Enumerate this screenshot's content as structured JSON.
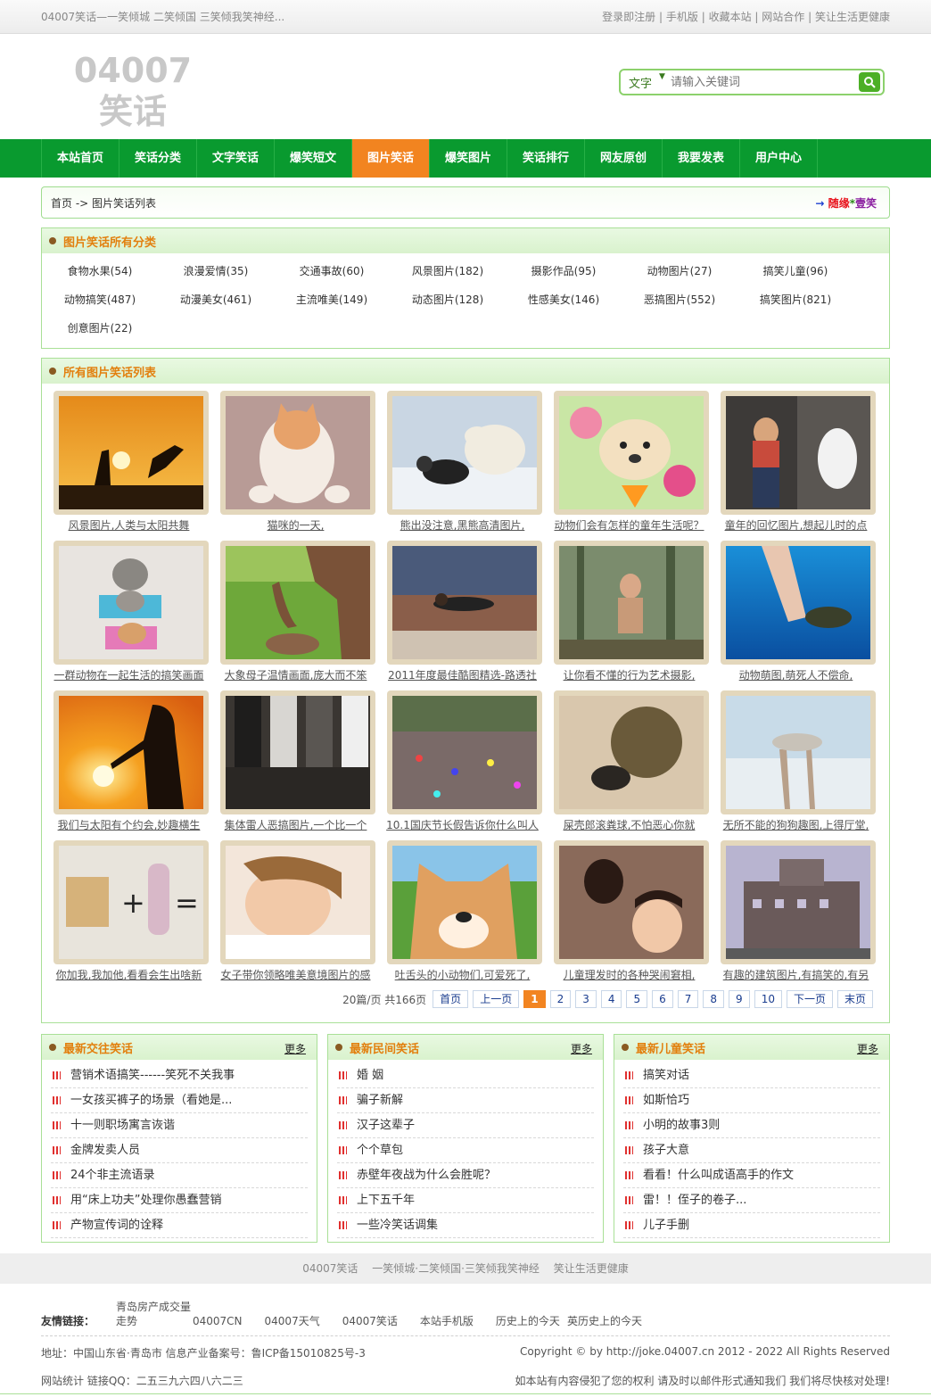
{
  "topbar": {
    "slogan": "04007笑话—一笑倾城 二笑倾国 三笑倾我笑神经...",
    "links": [
      "登录即注册",
      "手机版",
      "收藏本站",
      "网站合作",
      "笑让生活更健康"
    ]
  },
  "header": {
    "logo": "04007笑话",
    "search_type": "文字",
    "search_placeholder": "请输入关键词"
  },
  "nav": [
    {
      "label": "本站首页",
      "active": false
    },
    {
      "label": "笑话分类",
      "active": false
    },
    {
      "label": "文字笑话",
      "active": false
    },
    {
      "label": "爆笑短文",
      "active": false
    },
    {
      "label": "图片笑话",
      "active": true
    },
    {
      "label": "爆笑图片",
      "active": false
    },
    {
      "label": "笑话排行",
      "active": false
    },
    {
      "label": "网友原创",
      "active": false
    },
    {
      "label": "我要发表",
      "active": false
    },
    {
      "label": "用户中心",
      "active": false
    }
  ],
  "crumb": {
    "path": "首页 -> 图片笑话列表",
    "random_arrow": "→",
    "random_a": "随",
    "random_b": "缘",
    "random_c": "*",
    "random_d": "壹笑"
  },
  "categories": {
    "title": "图片笑话所有分类",
    "items": [
      "食物水果(54)",
      "浪漫爱情(35)",
      "交通事故(60)",
      "风景图片(182)",
      "摄影作品(95)",
      "动物图片(27)",
      "搞笑儿童(96)",
      "动物搞笑(487)",
      "动漫美女(461)",
      "主流唯美(149)",
      "动态图片(128)",
      "性感美女(146)",
      "恶搞图片(552)",
      "搞笑图片(821)",
      "创意图片(22)"
    ]
  },
  "list": {
    "title": "所有图片笑话列表",
    "items": [
      {
        "caption": "风景图片,人类与太阳共舞",
        "pic": "sunset-silhouette"
      },
      {
        "caption": "猫咪的一天,",
        "pic": "sleeping-cat"
      },
      {
        "caption": "熊出没注意,黑熊高清图片,",
        "pic": "polar-bear-dog"
      },
      {
        "caption": "动物们会有怎样的童年生活呢？",
        "pic": "puppy-toys"
      },
      {
        "caption": "童年的回忆图片,想起儿时的点",
        "pic": "kid-urinal"
      },
      {
        "caption": "一群动物在一起生活的搞笑画面",
        "pic": "cats-baskets"
      },
      {
        "caption": "大象母子温情画面,庞大而不笨",
        "pic": "elephant-calf"
      },
      {
        "caption": "2011年度最佳酷图精选-路透社",
        "pic": "track-athlete"
      },
      {
        "caption": "让你看不懂的行为艺术摄影,",
        "pic": "forest-man"
      },
      {
        "caption": "动物萌图,萌死人不偿命,",
        "pic": "underwater-turtle"
      },
      {
        "caption": "我们与太阳有个约会,妙趣横生",
        "pic": "sun-hands"
      },
      {
        "caption": "集体雷人恶搞图片,一个比一个",
        "pic": "crowd-legs"
      },
      {
        "caption": "10.1国庆节长假告诉你什么叫人",
        "pic": "holiday-crowd"
      },
      {
        "caption": "屎壳郎滚粪球,不怕恶心你就",
        "pic": "dung-beetle"
      },
      {
        "caption": "无所不能的狗狗趣图,上得厅堂,",
        "pic": "dog-stilts"
      },
      {
        "caption": "你加我,我加他,看看会生出啥新",
        "pic": "cat-plus-shaver"
      },
      {
        "caption": "女子带你领略唯美意境图片的感",
        "pic": "sleeping-girl"
      },
      {
        "caption": "吐舌头的小动物们,可爱死了,",
        "pic": "shiba-dog"
      },
      {
        "caption": "儿童理发时的各种哭闹窘相,",
        "pic": "baby-haircut"
      },
      {
        "caption": "有趣的建筑图片,有搞笑的,有另",
        "pic": "building"
      }
    ]
  },
  "pager": {
    "info": "20篇/页 共166页",
    "first": "首页",
    "prev": "上一页",
    "pages": [
      "1",
      "2",
      "3",
      "4",
      "5",
      "6",
      "7",
      "8",
      "9",
      "10"
    ],
    "current": "1",
    "next": "下一页",
    "last": "末页"
  },
  "bottom_boxes": [
    {
      "title": "最新交往笑话",
      "more": "更多",
      "items": [
        "营销术语搞笑------笑死不关我事",
        "一女孩买裤子的场景（看她是...",
        "十一则职场寓言诙谐",
        "金牌发卖人员",
        "24个非主流语录",
        "用“床上功夫”处理你愚蠢营销",
        "产物宣传词的诠释"
      ]
    },
    {
      "title": "最新民间笑话",
      "more": "更多",
      "items": [
        "婚 姻",
        "骗子新解",
        "汉子这辈子",
        "个个草包",
        "赤壁年夜战为什么会胜呢？",
        "上下五千年",
        "一些冷笑话调集"
      ]
    },
    {
      "title": "最新儿童笑话",
      "more": "更多",
      "items": [
        "搞笑对话",
        "如斯恰巧",
        "小明的故事3则",
        "孩子大意",
        "看看！什么叫成语高手的作文",
        "雷！！侄子的卷子...",
        "儿子手删"
      ]
    }
  ],
  "footer": {
    "nav": [
      "04007笑话",
      "一笑倾城·二笑倾国·三笑倾我笑神经",
      "笑让生活更健康"
    ],
    "friends_label": "友情链接：",
    "friends": [
      "青岛房产成交量走势",
      "04007CN",
      "04007天气",
      "04007笑话",
      "本站手机版",
      "历史上的今天",
      "英历史上的今天"
    ],
    "address": "地址：中国山东省·青岛市 信息产业备案号：鲁ICP备15010825号-3",
    "copyright": "Copyright © by http://joke.04007.cn 2012 - 2022 All Rights Reserved",
    "stats": "网站统计 链接QQ：二五三九六四八六二三",
    "notice": "如本站有内容侵犯了您的权利 请及时以邮件形式通知我们 我们将尽快核对处理!"
  }
}
